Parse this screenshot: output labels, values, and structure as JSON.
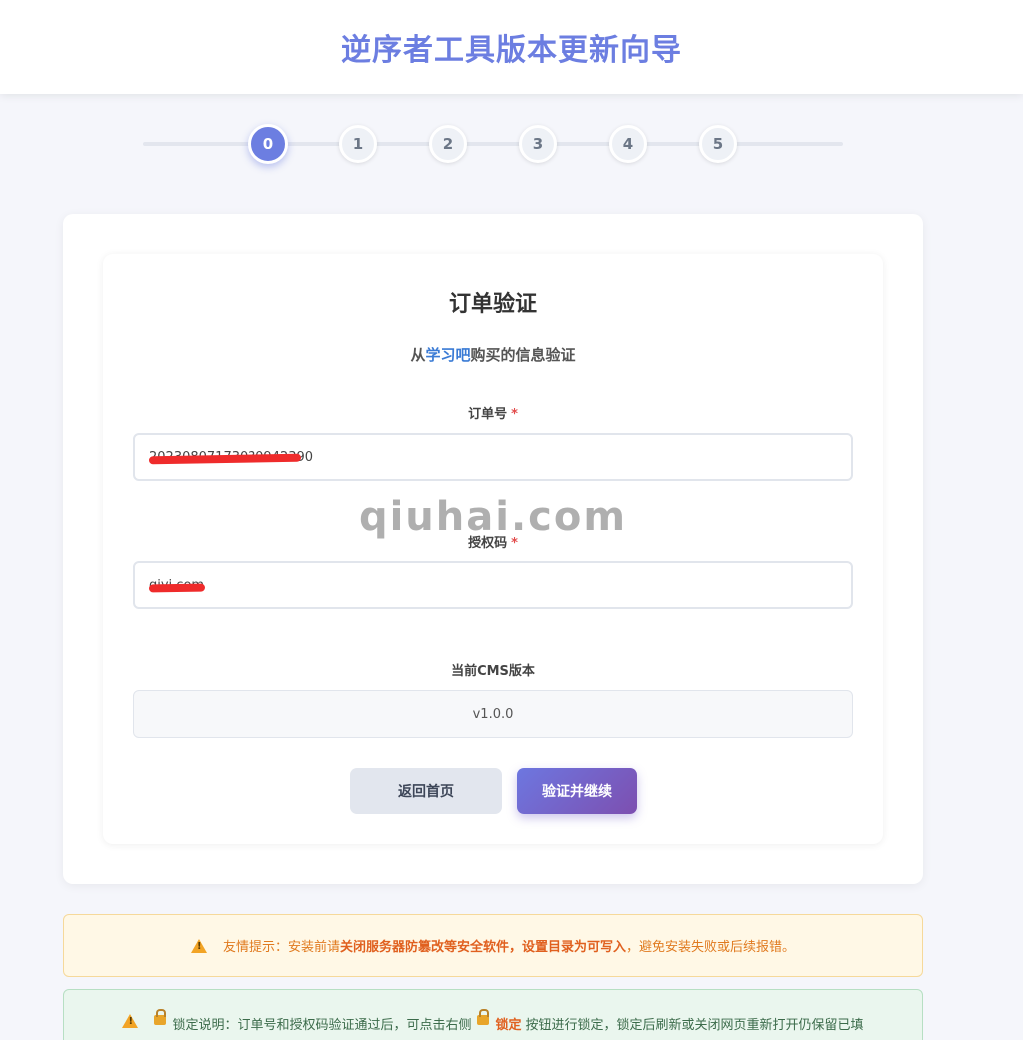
{
  "header": {
    "title": "逆序者工具版本更新向导"
  },
  "steps": [
    "0",
    "1",
    "2",
    "3",
    "4",
    "5"
  ],
  "card": {
    "title": "订单验证",
    "subtitle_prefix": "从",
    "subtitle_link": "学习吧",
    "subtitle_suffix": "购买的信息验证",
    "order_label": "订单号",
    "order_value": "202308071730?0942390",
    "auth_label": "授权码",
    "auth_value": "qiyi.com",
    "required_mark": "*",
    "cms_label": "当前CMS版本",
    "cms_value": "v1.0.0",
    "back_button": "返回首页",
    "verify_button": "验证并继续"
  },
  "watermark": "qiuhai.com",
  "notices": {
    "warn_prefix": "友情提示：安装前请",
    "warn_bold1": "关闭服务器防篡改等安全软件",
    "warn_sep": "，",
    "warn_bold2": "设置目录为可写入",
    "warn_suffix": "，避免安装失败或后续报错。",
    "lock_prefix": "锁定说明：订单号和授权码验证通过后，可点击右侧",
    "lock_bold": "锁定",
    "lock_suffix": "按钮进行锁定，锁定后刷新或关闭网页重新打开仍保留已填"
  },
  "colors": {
    "accent": "#6c7ee1",
    "link": "#3a7bd5",
    "warn_text": "#e07a1f",
    "required": "#e24b4b"
  }
}
